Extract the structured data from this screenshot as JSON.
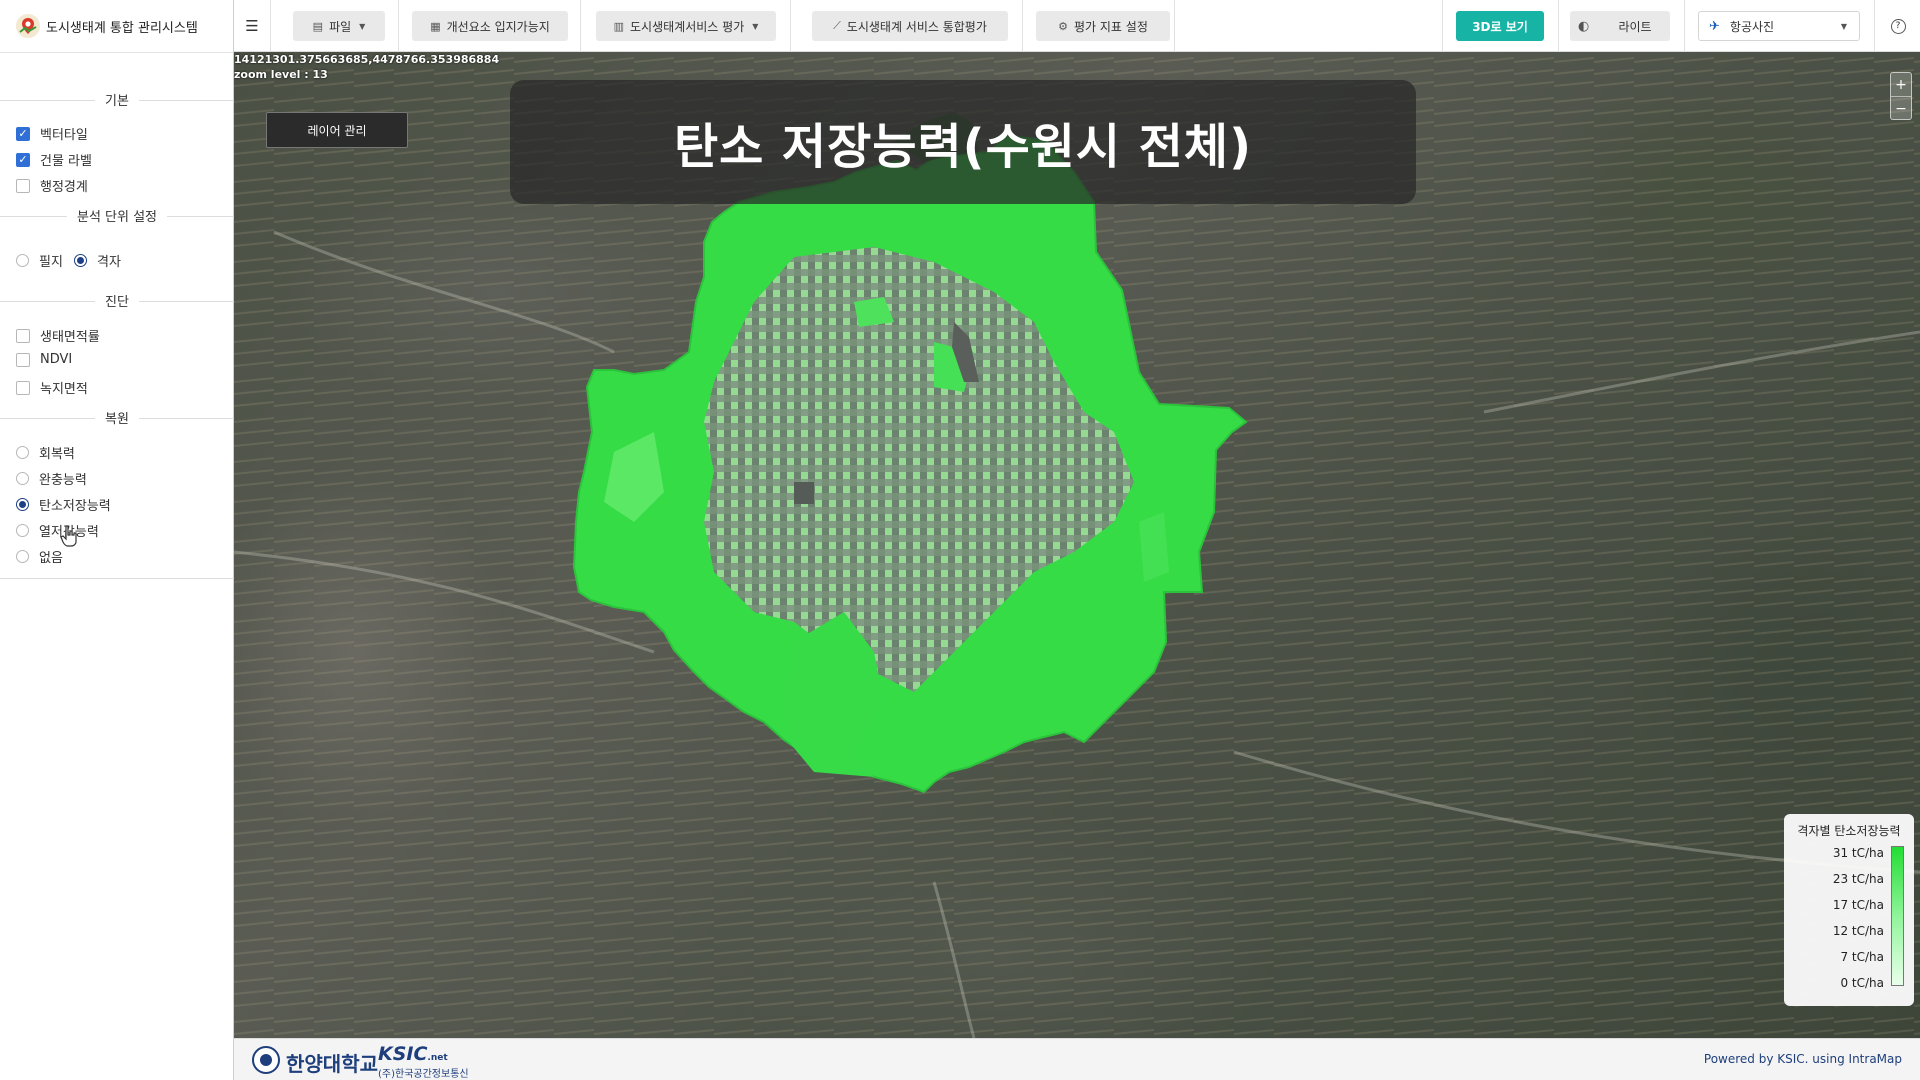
{
  "app": {
    "title": "도시생태계 통합 관리시스템"
  },
  "toolbar": {
    "menu_icon": "hamburger-icon",
    "file": "파일",
    "improvement": "개선요소 입지가능지",
    "eval": "도시생태계서비스 평가",
    "integrated": "도시생태계 서비스 통합평가",
    "settings": "평가 지표 설정",
    "view3d": "3D로 보기",
    "theme": "라이트",
    "basemap": "항공사진",
    "help": "?",
    "accent_color": "#17b4a6"
  },
  "sidebar": {
    "basic": {
      "title": "기본",
      "items": [
        {
          "label": "벡터타일",
          "checked": true
        },
        {
          "label": "건물 라벨",
          "checked": true
        },
        {
          "label": "행정경계",
          "checked": false
        }
      ]
    },
    "unit": {
      "title": "분석 단위 설정",
      "options": [
        {
          "label": "필지",
          "selected": false
        },
        {
          "label": "격자",
          "selected": true
        }
      ]
    },
    "diagnosis": {
      "title": "진단",
      "items": [
        {
          "label": "생태면적률",
          "checked": false
        },
        {
          "label": "NDVI",
          "checked": false
        },
        {
          "label": "녹지면적",
          "checked": false
        }
      ]
    },
    "restore": {
      "title": "복원",
      "options": [
        {
          "label": "회복력",
          "selected": false
        },
        {
          "label": "완충능력",
          "selected": false
        },
        {
          "label": "탄소저장능력",
          "selected": true
        },
        {
          "label": "열저감능력",
          "selected": false
        },
        {
          "label": "없음",
          "selected": false
        }
      ]
    }
  },
  "map": {
    "coords": "14121301.375663685,4478766.353986884",
    "zoom": "zoom level : 13",
    "layer_button": "레이어 관리",
    "title": "탄소 저장능력(수원시 전체)",
    "zoom_in": "+",
    "zoom_out": "−",
    "legend": {
      "title": "격자별 탄소저장능력",
      "labels": [
        "31 tC/ha",
        "23 tC/ha",
        "17 tC/ha",
        "12 tC/ha",
        "7 tC/ha",
        "0 tC/ha"
      ],
      "color_max": "#22dd33",
      "color_min": "#e9ffea"
    }
  },
  "footer": {
    "university": "한양대학교",
    "company_logo": "KSIC",
    "company_domain": ".net",
    "company": "(주)한국공간정보통신",
    "powered": "Powered by KSIC. using IntraMap"
  }
}
